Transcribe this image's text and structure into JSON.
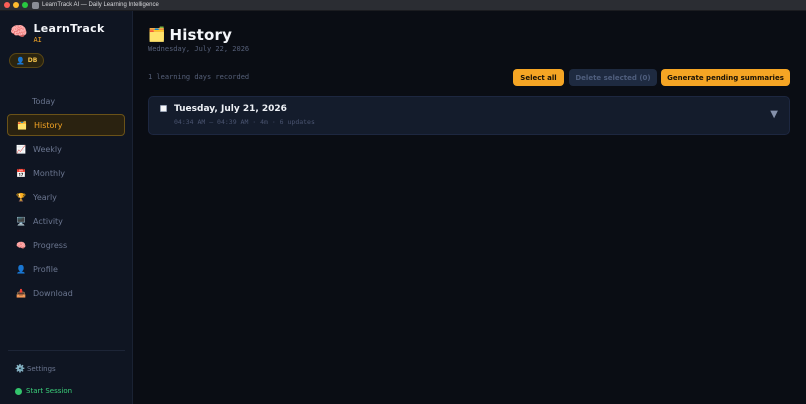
{
  "window": {
    "title": "LearnTrack AI — Daily Learning Intelligence"
  },
  "brand": {
    "name": "LearnTrack",
    "sub": "AI",
    "icon": "brain-icon"
  },
  "user": {
    "badge": "DB",
    "icon": "user-icon"
  },
  "sidebar": {
    "items": [
      {
        "label": "Today",
        "icon": "",
        "active": false
      },
      {
        "label": "History",
        "icon": "folder-icon",
        "glyph": "🗂️",
        "active": true
      },
      {
        "label": "Weekly",
        "icon": "chart-icon",
        "glyph": "📈",
        "active": false
      },
      {
        "label": "Monthly",
        "icon": "calendar-icon",
        "glyph": "📅",
        "active": false
      },
      {
        "label": "Yearly",
        "icon": "trophy-icon",
        "glyph": "🏆",
        "active": false
      },
      {
        "label": "Activity",
        "icon": "monitor-icon",
        "glyph": "🖥️",
        "active": false
      },
      {
        "label": "Progress",
        "icon": "brain-icon",
        "glyph": "🧠",
        "active": false
      },
      {
        "label": "Profile",
        "icon": "user-icon",
        "glyph": "👤",
        "active": false
      },
      {
        "label": "Download",
        "icon": "inbox-tray-icon",
        "glyph": "📥",
        "active": false
      }
    ],
    "settings_label": "Settings",
    "start_session_label": "Start Session"
  },
  "main": {
    "title": "History",
    "title_icon": "folder-icon",
    "date": "Wednesday, July 22, 2026",
    "count_text": "1 learning days recorded",
    "buttons": {
      "select_all": "Select all",
      "delete_selected": "Delete selected (0)",
      "generate_pending": "Generate pending summaries"
    },
    "days": [
      {
        "title": "Tuesday, July 21, 2026",
        "meta": "04:34 AM – 04:39 AM · 4m · 6 updates",
        "checked": false
      }
    ]
  },
  "colors": {
    "accent": "#f5a524",
    "sidebar_bg": "#0f1522",
    "main_bg": "#0a0d14",
    "card_bg": "#141c2c",
    "start_session": "#3bd07a"
  }
}
